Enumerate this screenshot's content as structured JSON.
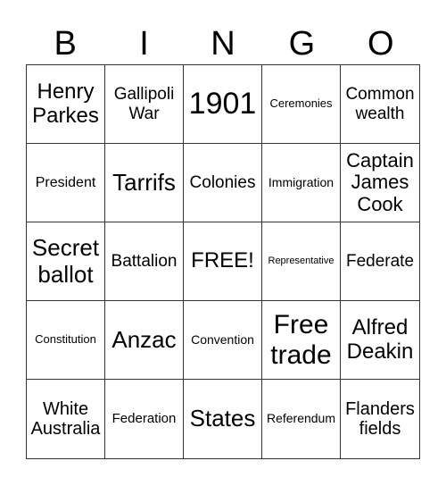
{
  "header": [
    "B",
    "I",
    "N",
    "G",
    "O"
  ],
  "cells": [
    "Henry Parkes",
    "Gallipoli War",
    "1901",
    "Ceremonies",
    "Common wealth",
    "President",
    "Tarrifs",
    "Colonies",
    "Immigration",
    "Captain James Cook",
    "Secret ballot",
    "Battalion",
    "FREE!",
    "Representative",
    "Federate",
    "Constitution",
    "Anzac",
    "Convention",
    "Free trade",
    "Alfred Deakin",
    "White Australia",
    "Federation",
    "States",
    "Referendum",
    "Flanders fields"
  ]
}
